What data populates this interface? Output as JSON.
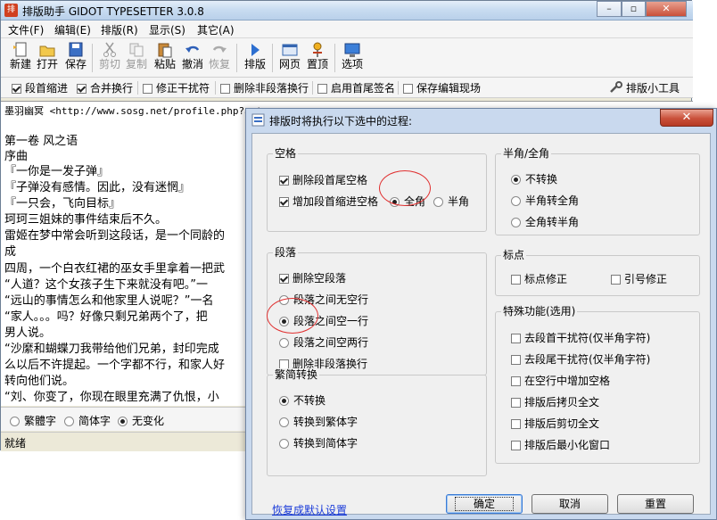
{
  "main_window": {
    "title": "排版助手 GIDOT TYPESETTER 3.0.8",
    "menu": [
      "文件(F)",
      "编辑(E)",
      "排版(R)",
      "显示(S)",
      "其它(A)"
    ],
    "toolbar": [
      {
        "label": "新建",
        "icon": "new-doc-icon",
        "disabled": false
      },
      {
        "label": "打开",
        "icon": "folder-open-icon",
        "disabled": false
      },
      {
        "label": "保存",
        "icon": "floppy-icon",
        "disabled": false
      },
      {
        "label": "剪切",
        "icon": "scissors-icon",
        "disabled": true
      },
      {
        "label": "复制",
        "icon": "copy-icon",
        "disabled": true
      },
      {
        "label": "粘贴",
        "icon": "paste-icon",
        "disabled": false
      },
      {
        "label": "撤消",
        "icon": "undo-icon",
        "disabled": false
      },
      {
        "label": "恢复",
        "icon": "redo-icon",
        "disabled": true
      },
      {
        "label": "排版",
        "icon": "play-icon",
        "disabled": false
      },
      {
        "label": "网页",
        "icon": "web-icon",
        "disabled": false
      },
      {
        "label": "置顶",
        "icon": "pin-icon",
        "disabled": false
      },
      {
        "label": "选项",
        "icon": "monitor-icon",
        "disabled": false
      }
    ],
    "options": [
      {
        "label": "段首缩进",
        "checked": true
      },
      {
        "label": "合并换行",
        "checked": true
      },
      {
        "label": "修正干扰符",
        "checked": false
      },
      {
        "label": "删除非段落换行",
        "checked": false
      },
      {
        "label": "启用首尾签名",
        "checked": false
      },
      {
        "label": "保存编辑现场",
        "checked": false
      }
    ],
    "tools_label": "排版小工具",
    "editor_lines": [
      "墨羽幽冥 <http://www.sosg.net/profile.php?act",
      "",
      "第一卷 风之语",
      "序曲",
      "『一你是一发子弹』",
      "『子弹没有感情。因此，没有迷惘』",
      "『一只会，飞向目标』",
      "珂珂三姐妹的事件结束后不久。",
      "雷姬在梦中常会听到这段话，是一个同龄的",
      "成",
      "四周，一个白衣红裙的巫女手里拿着一把武",
      "“人道？这个女孩子生下来就没有吧。”一",
      "“远山的事情怎么和他家里人说呢？”一名",
      "“家人。。。吗？好像只剩兄弟两个了，把",
      "男人说。",
      "“沙縻和蝴蝶刀我带给他们兄弟，封印完成",
      "么以后不许提起。一个字都不行，和家人好",
      "转向他们说。",
      "“刘、你变了，你现在眼里充满了仇恨，小"
    ],
    "conversion": [
      {
        "label": "繁體字",
        "selected": false
      },
      {
        "label": "简体字",
        "selected": false
      },
      {
        "label": "无变化",
        "selected": true
      }
    ],
    "status": "就绪"
  },
  "dialog": {
    "title": "排版时将执行以下选中的过程:",
    "close_label": "✕",
    "spacing": {
      "title": "空格",
      "delete_spaces": {
        "label": "删除段首尾空格",
        "checked": true
      },
      "add_indent": {
        "label": "增加段首缩进空格",
        "checked": true
      },
      "full_width": {
        "label": "全角",
        "selected": true
      },
      "half_width": {
        "label": "半角",
        "selected": false
      }
    },
    "paragraph": {
      "title": "段落",
      "delete_empty": {
        "label": "删除空段落",
        "checked": true
      },
      "options": [
        {
          "label": "段落之间无空行",
          "selected": false
        },
        {
          "label": "段落之间空一行",
          "selected": true
        },
        {
          "label": "段落之间空两行",
          "selected": false
        }
      ],
      "delete_non_para": {
        "label": "删除非段落换行",
        "checked": false
      }
    },
    "trad_simp": {
      "title": "繁简转换",
      "options": [
        {
          "label": "不转换",
          "selected": true
        },
        {
          "label": "转换到繁体字",
          "selected": false
        },
        {
          "label": "转换到简体字",
          "selected": false
        }
      ]
    },
    "width": {
      "title": "半角/全角",
      "options": [
        {
          "label": "不转换",
          "selected": true
        },
        {
          "label": "半角转全角",
          "selected": false
        },
        {
          "label": "全角转半角",
          "selected": false
        }
      ]
    },
    "punctuation": {
      "title": "标点",
      "items": [
        {
          "label": "标点修正",
          "checked": false
        },
        {
          "label": "引号修正",
          "checked": false
        }
      ]
    },
    "special": {
      "title": "特殊功能(选用)",
      "items": [
        {
          "label": "去段首干扰符(仅半角字符)",
          "checked": false
        },
        {
          "label": "去段尾干扰符(仅半角字符)",
          "checked": false
        },
        {
          "label": "在空行中增加空格",
          "checked": false
        },
        {
          "label": "排版后拷贝全文",
          "checked": false
        },
        {
          "label": "排版后剪切全文",
          "checked": false
        },
        {
          "label": "排版后最小化窗口",
          "checked": false
        }
      ]
    },
    "restore_link": "恢复成默认设置",
    "buttons": {
      "ok": "确定",
      "cancel": "取消",
      "reset": "重置"
    }
  }
}
